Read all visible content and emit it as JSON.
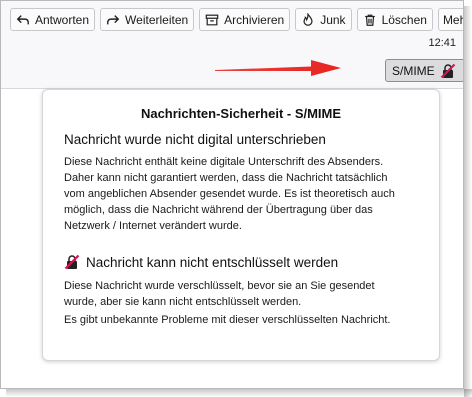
{
  "toolbar": {
    "reply": "Antworten",
    "forward": "Weiterleiten",
    "archive": "Archivieren",
    "junk": "Junk",
    "delete": "Löschen",
    "more": "Mehr"
  },
  "time": "12:41",
  "smime_button": {
    "label": "S/MIME"
  },
  "colors": {
    "arrow": "#e8231f",
    "lock_red": "#d4145a"
  },
  "popup": {
    "title": "Nachrichten-Sicherheit - S/MIME",
    "signature": {
      "heading": "Nachricht wurde nicht digital unterschrieben",
      "lines": [
        "Diese Nachricht enthält keine digitale Unterschrift des Absenders.",
        "Daher kann nicht garantiert werden, dass die Nachricht tatsächlich",
        "vom angeblichen Absender gesendet wurde. Es ist theoretisch auch",
        "möglich, dass die Nachricht während der Übertragung über das",
        "Netzwerk / Internet verändert wurde."
      ]
    },
    "encryption": {
      "heading": "Nachricht kann nicht entschlüsselt werden",
      "lines": [
        "Diese Nachricht wurde verschlüsselt, bevor sie an Sie gesendet",
        "wurde, aber sie kann nicht entschlüsselt werden."
      ],
      "note": "Es gibt unbekannte Probleme mit dieser verschlüsselten Nachricht."
    }
  }
}
